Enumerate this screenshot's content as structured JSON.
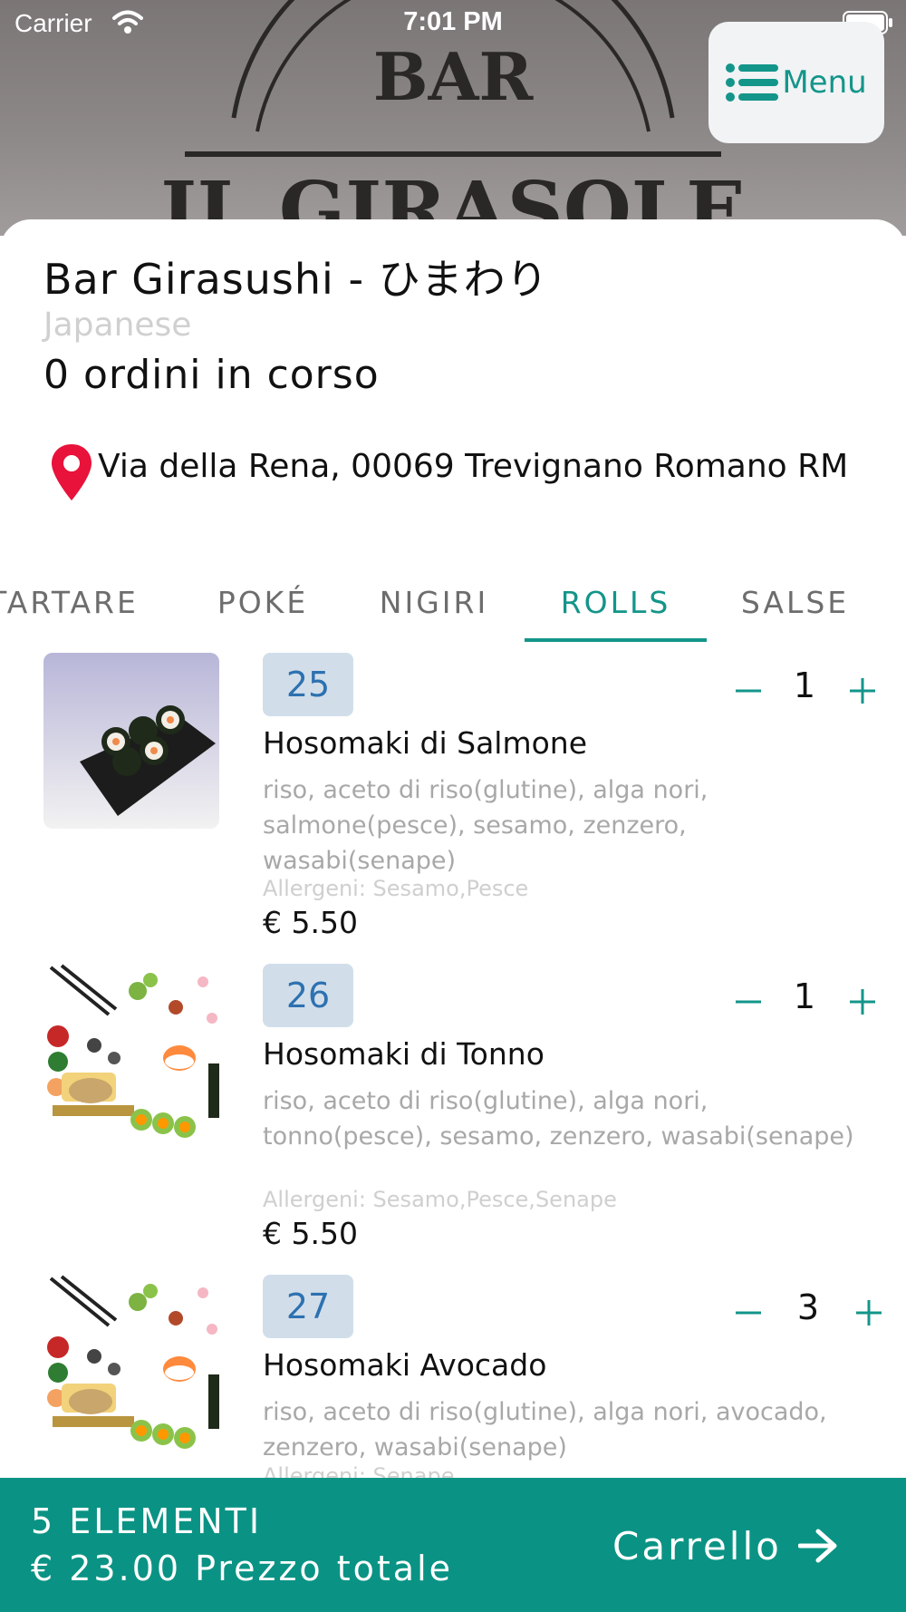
{
  "status_bar": {
    "carrier": "Carrier",
    "time": "7:01 PM"
  },
  "hero": {
    "logo_line1": "BAR",
    "logo_line2": "IL GIRASOLE"
  },
  "menu_button": {
    "label": "Menu",
    "icon": "list-icon"
  },
  "restaurant": {
    "name": "Bar Girasushi - ひまわり",
    "cuisine": "Japanese",
    "orders_status": "0 ordini in corso",
    "address": "Via della Rena, 00069 Trevignano Romano RM"
  },
  "tabs": [
    {
      "label": "TARTARE"
    },
    {
      "label": "POKÉ"
    },
    {
      "label": "NIGIRI"
    },
    {
      "label": "ROLLS",
      "active": true
    },
    {
      "label": "SALSE"
    }
  ],
  "items": [
    {
      "number": "25",
      "name": "Hosomaki di Salmone",
      "description": "riso, aceto di riso(glutine), alga nori, salmone(pesce), sesamo, zenzero, wasabi(senape)",
      "allergens": "Allergeni: Sesamo,Pesce",
      "price": "€ 5.50",
      "quantity": "1",
      "image": "salmon-hosomaki-photo"
    },
    {
      "number": "26",
      "name": "Hosomaki di Tonno",
      "description": "riso, aceto di riso(glutine), alga nori, tonno(pesce), sesamo, zenzero, wasabi(senape)",
      "allergens": "Allergeni: Sesamo,Pesce,Senape",
      "price": "€ 5.50",
      "quantity": "1",
      "image": "sushi-illustration"
    },
    {
      "number": "27",
      "name": "Hosomaki Avocado",
      "description": "riso, aceto di riso(glutine), alga nori, avocado, zenzero, wasabi(senape)",
      "allergens": "Allergeni: Senape",
      "price": "",
      "quantity": "3",
      "image": "sushi-illustration"
    }
  ],
  "cart": {
    "count_label": "5 ELEMENTI",
    "total_label": "€ 23.00 Prezzo totale",
    "button_label": "Carrello"
  },
  "colors": {
    "accent": "#14958a",
    "cart_bar": "#0a9384",
    "badge_bg": "#d1deea",
    "badge_text": "#2d71b0",
    "pin": "#e8123a"
  }
}
